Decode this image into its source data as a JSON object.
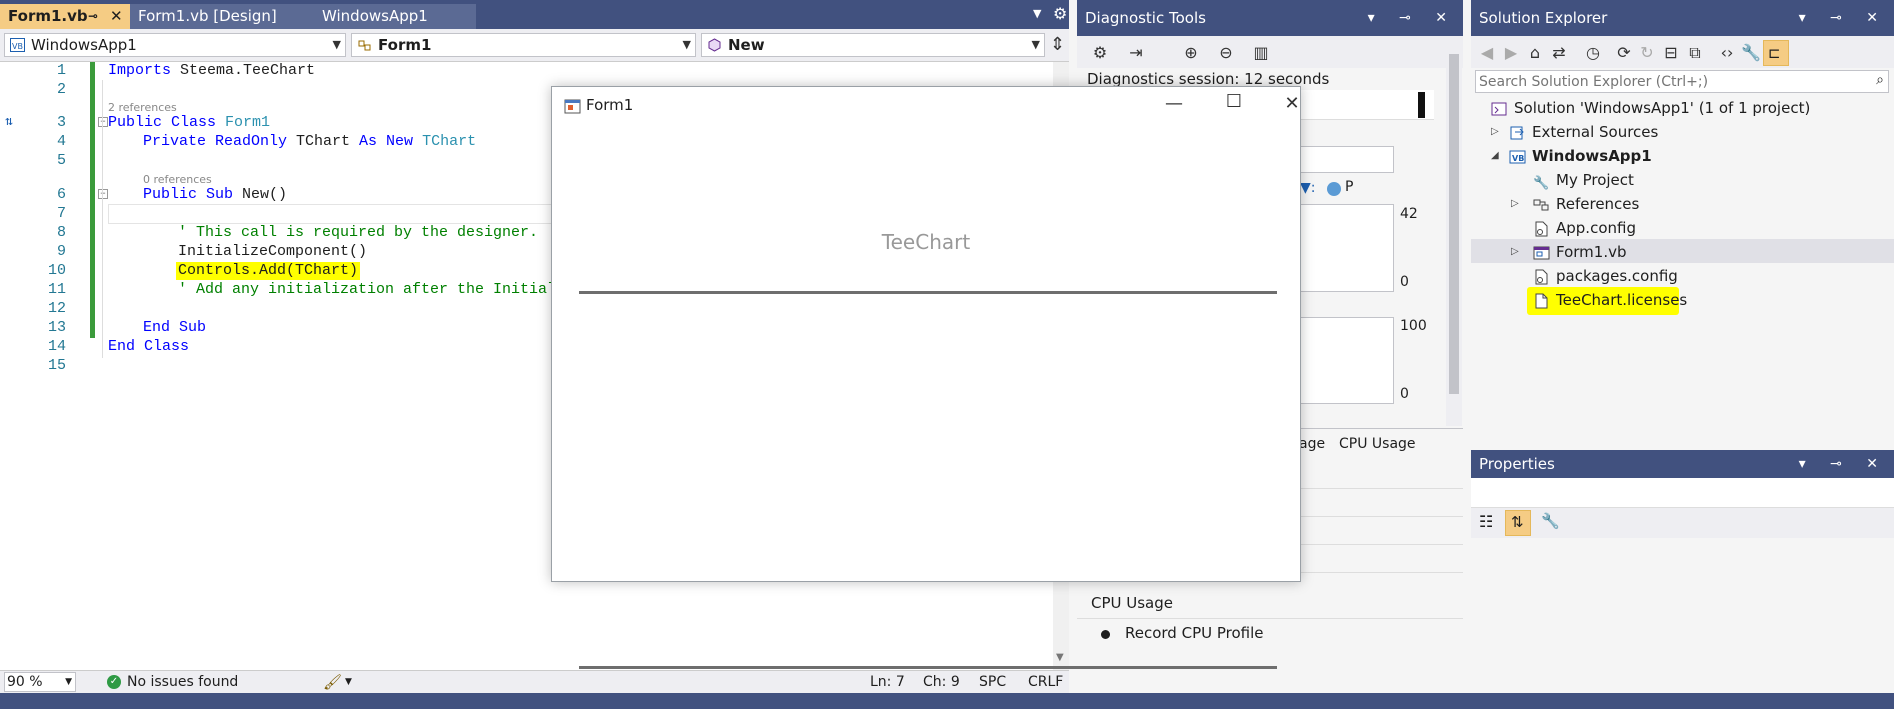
{
  "editor": {
    "tabs": [
      {
        "label": "Form1.vb",
        "active": true
      },
      {
        "label": "Form1.vb [Design]",
        "active": false
      },
      {
        "label": "WindowsApp1",
        "active": false
      }
    ],
    "nav": {
      "project": "WindowsApp1",
      "class": "Form1",
      "member": "New"
    },
    "line_numbers": [
      "1",
      "2",
      "3",
      "4",
      "5",
      "6",
      "7",
      "8",
      "9",
      "10",
      "11",
      "12",
      "13",
      "14",
      "15"
    ],
    "refs": {
      "class_refs": "2 references",
      "sub_refs": "0 references"
    },
    "code": {
      "l1_kw": "Imports",
      "l1_rest": " Steema.TeeChart",
      "l3_kw": "Public Class",
      "l3_ty": " Form1",
      "l4_kw1": "Private ReadOnly",
      "l4_mid": " TChart ",
      "l4_kw2": "As New",
      "l4_ty": " TChart",
      "l6_kw": "Public Sub",
      "l6_rest": " New()",
      "l8_cm": "' This call is required by the designer.",
      "l9": "InitializeComponent()",
      "l10": "Controls.Add(TChart)",
      "l11_cm": "' Add any initialization after the Initializ",
      "l13_kw": "End Sub",
      "l14_kw": "End Class"
    },
    "status": {
      "zoom": "90 %",
      "issues": "No issues found",
      "ln": "Ln: 7",
      "ch": "Ch: 9",
      "spc": "SPC",
      "crlf": "CRLF"
    }
  },
  "diag": {
    "title": "Diagnostic Tools",
    "session": "Diagnostics session: 12 seconds",
    "legend_p": "P",
    "chart1": {
      "max": "42",
      "min": "0"
    },
    "chart2": {
      "max": "100",
      "min": "0"
    },
    "tabs_partial": "age",
    "tab_cpu": "CPU Usage",
    "cpu_header": "CPU Usage",
    "record": "Record CPU Profile"
  },
  "sol": {
    "title": "Solution Explorer",
    "search_placeholder": "Search Solution Explorer (Ctrl+;)",
    "items": [
      {
        "label": "Solution 'WindowsApp1' (1 of 1 project)"
      },
      {
        "label": "External Sources"
      },
      {
        "label": "WindowsApp1"
      },
      {
        "label": "My Project"
      },
      {
        "label": "References"
      },
      {
        "label": "App.config"
      },
      {
        "label": "Form1.vb"
      },
      {
        "label": "packages.config"
      },
      {
        "label": "TeeChart.licenses"
      }
    ]
  },
  "props": {
    "title": "Properties"
  },
  "form1": {
    "title": "Form1",
    "chart_title": "TeeChart"
  },
  "colors": {
    "titlebar": "#41517f",
    "active_tab": "#f5cc84",
    "highlight": "#ffff00"
  }
}
